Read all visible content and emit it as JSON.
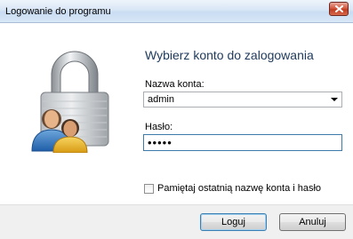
{
  "window": {
    "title": "Logowanie do programu"
  },
  "icons": {
    "close": "close-icon",
    "lock": "padlock-users-icon",
    "combo": "chevron-down-icon"
  },
  "form": {
    "heading": "Wybierz konto do zalogowania",
    "account_label": "Nazwa konta:",
    "account_value": "admin",
    "password_label": "Hasło:",
    "password_value": "•••••",
    "remember_label": "Pamiętaj ostatnią nazwę konta i hasło",
    "remember_checked": false
  },
  "buttons": {
    "login": "Loguj",
    "cancel": "Anuluj"
  },
  "colors": {
    "heading": "#1e395b",
    "focus_border": "#3d7bad",
    "close": "#c13d22"
  }
}
